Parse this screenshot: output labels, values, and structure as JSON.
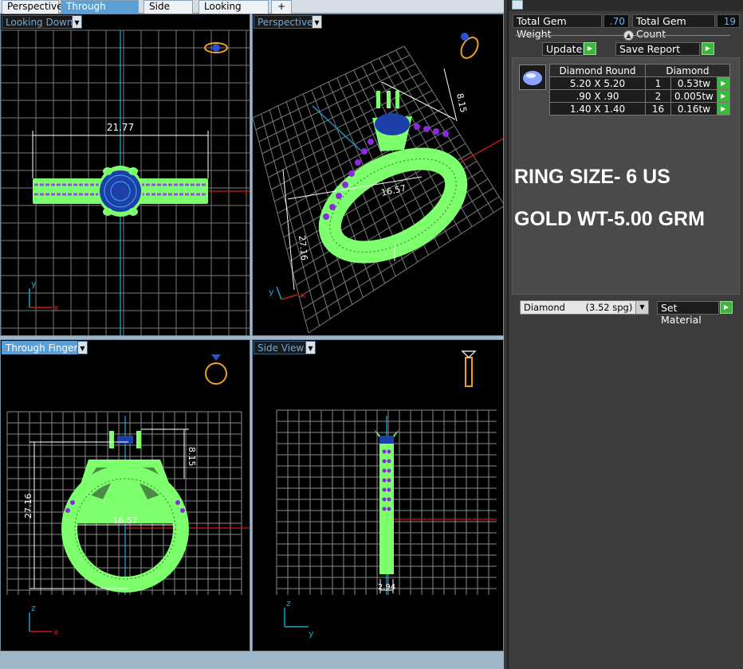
{
  "tabs": [
    {
      "label": "Perspective",
      "active": false
    },
    {
      "label": "Through Finger",
      "active": true
    },
    {
      "label": "Side View",
      "active": false
    },
    {
      "label": "Looking Down",
      "active": false
    }
  ],
  "add_tab_glyph": "+",
  "viewports": {
    "top_left": {
      "label": "Looking Down",
      "dimension": "21.77"
    },
    "top_right": {
      "label": "Perspective",
      "dim_height": "8.15",
      "dim_inner": "16.57",
      "dim_total": "27.16"
    },
    "bottom_left": {
      "label": "Through Finger",
      "dim_height": "8.15",
      "dim_inner": "16.57",
      "dim_total": "27.16"
    },
    "bottom_right": {
      "label": "Side View",
      "dim_width": "2.94"
    }
  },
  "axis_labels": {
    "x": "x",
    "y": "y",
    "z": "z"
  },
  "panel": {
    "total_gem_weight_label": "Total Gem Weight",
    "total_gem_weight_value": ".70",
    "total_gem_count_label": "Total Gem Count",
    "total_gem_count_value": "19",
    "update_label": "Update",
    "save_report_label": "Save Report",
    "gem_table": {
      "headers": [
        "Diamond Round",
        "Diamond"
      ],
      "rows": [
        {
          "size": "5.20 X 5.20",
          "count": "1",
          "weight": "0.53tw"
        },
        {
          "size": ".90 X .90",
          "count": "2",
          "weight": "0.005tw"
        },
        {
          "size": "1.40 X 1.40",
          "count": "16",
          "weight": "0.16tw"
        }
      ]
    },
    "note_ring_size": "RING SIZE- 6 US",
    "note_gold_weight": "GOLD WT-5.00 GRM",
    "material_select": "Diamond       (3.52 spg)",
    "set_material_label": "Set Material"
  },
  "colors": {
    "ring_green": "#7dff6e",
    "stone_blue": "#1d3fa8",
    "accent_purple": "#8a2be2",
    "axis_cyan": "#1aa6c8",
    "axis_red": "#d01818",
    "grid": "#8a8a8a",
    "label_blue": "#6fb0e8"
  },
  "icons": [
    "ring-top-icon",
    "ring-perspective-icon",
    "ring-front-icon",
    "ring-side-icon",
    "arrow-right-icon",
    "chevron-down-icon",
    "gem-round-icon"
  ]
}
